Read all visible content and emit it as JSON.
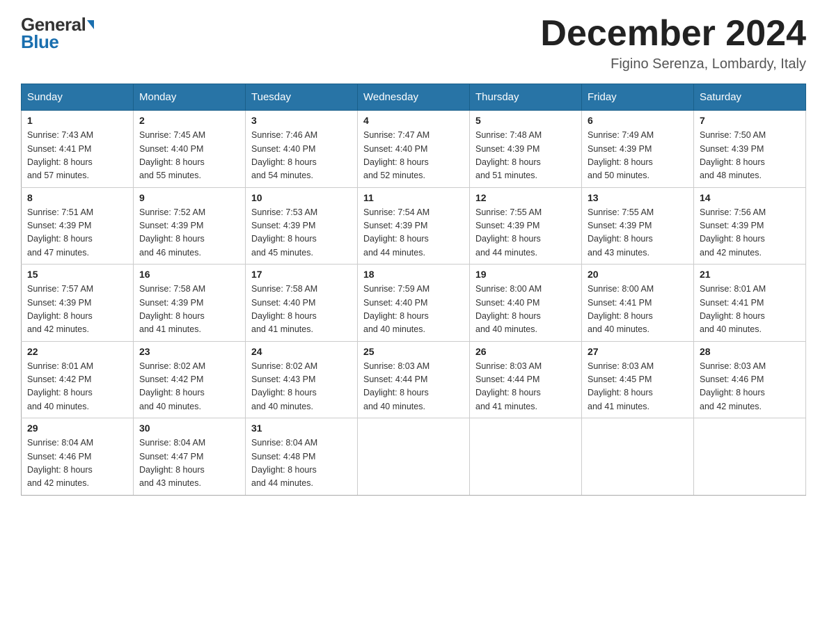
{
  "header": {
    "logo_general": "General",
    "logo_blue": "Blue",
    "month_title": "December 2024",
    "location": "Figino Serenza, Lombardy, Italy"
  },
  "days_of_week": [
    "Sunday",
    "Monday",
    "Tuesday",
    "Wednesday",
    "Thursday",
    "Friday",
    "Saturday"
  ],
  "weeks": [
    [
      {
        "day": "1",
        "sunrise": "7:43 AM",
        "sunset": "4:41 PM",
        "daylight": "8 hours and 57 minutes."
      },
      {
        "day": "2",
        "sunrise": "7:45 AM",
        "sunset": "4:40 PM",
        "daylight": "8 hours and 55 minutes."
      },
      {
        "day": "3",
        "sunrise": "7:46 AM",
        "sunset": "4:40 PM",
        "daylight": "8 hours and 54 minutes."
      },
      {
        "day": "4",
        "sunrise": "7:47 AM",
        "sunset": "4:40 PM",
        "daylight": "8 hours and 52 minutes."
      },
      {
        "day": "5",
        "sunrise": "7:48 AM",
        "sunset": "4:39 PM",
        "daylight": "8 hours and 51 minutes."
      },
      {
        "day": "6",
        "sunrise": "7:49 AM",
        "sunset": "4:39 PM",
        "daylight": "8 hours and 50 minutes."
      },
      {
        "day": "7",
        "sunrise": "7:50 AM",
        "sunset": "4:39 PM",
        "daylight": "8 hours and 48 minutes."
      }
    ],
    [
      {
        "day": "8",
        "sunrise": "7:51 AM",
        "sunset": "4:39 PM",
        "daylight": "8 hours and 47 minutes."
      },
      {
        "day": "9",
        "sunrise": "7:52 AM",
        "sunset": "4:39 PM",
        "daylight": "8 hours and 46 minutes."
      },
      {
        "day": "10",
        "sunrise": "7:53 AM",
        "sunset": "4:39 PM",
        "daylight": "8 hours and 45 minutes."
      },
      {
        "day": "11",
        "sunrise": "7:54 AM",
        "sunset": "4:39 PM",
        "daylight": "8 hours and 44 minutes."
      },
      {
        "day": "12",
        "sunrise": "7:55 AM",
        "sunset": "4:39 PM",
        "daylight": "8 hours and 44 minutes."
      },
      {
        "day": "13",
        "sunrise": "7:55 AM",
        "sunset": "4:39 PM",
        "daylight": "8 hours and 43 minutes."
      },
      {
        "day": "14",
        "sunrise": "7:56 AM",
        "sunset": "4:39 PM",
        "daylight": "8 hours and 42 minutes."
      }
    ],
    [
      {
        "day": "15",
        "sunrise": "7:57 AM",
        "sunset": "4:39 PM",
        "daylight": "8 hours and 42 minutes."
      },
      {
        "day": "16",
        "sunrise": "7:58 AM",
        "sunset": "4:39 PM",
        "daylight": "8 hours and 41 minutes."
      },
      {
        "day": "17",
        "sunrise": "7:58 AM",
        "sunset": "4:40 PM",
        "daylight": "8 hours and 41 minutes."
      },
      {
        "day": "18",
        "sunrise": "7:59 AM",
        "sunset": "4:40 PM",
        "daylight": "8 hours and 40 minutes."
      },
      {
        "day": "19",
        "sunrise": "8:00 AM",
        "sunset": "4:40 PM",
        "daylight": "8 hours and 40 minutes."
      },
      {
        "day": "20",
        "sunrise": "8:00 AM",
        "sunset": "4:41 PM",
        "daylight": "8 hours and 40 minutes."
      },
      {
        "day": "21",
        "sunrise": "8:01 AM",
        "sunset": "4:41 PM",
        "daylight": "8 hours and 40 minutes."
      }
    ],
    [
      {
        "day": "22",
        "sunrise": "8:01 AM",
        "sunset": "4:42 PM",
        "daylight": "8 hours and 40 minutes."
      },
      {
        "day": "23",
        "sunrise": "8:02 AM",
        "sunset": "4:42 PM",
        "daylight": "8 hours and 40 minutes."
      },
      {
        "day": "24",
        "sunrise": "8:02 AM",
        "sunset": "4:43 PM",
        "daylight": "8 hours and 40 minutes."
      },
      {
        "day": "25",
        "sunrise": "8:03 AM",
        "sunset": "4:44 PM",
        "daylight": "8 hours and 40 minutes."
      },
      {
        "day": "26",
        "sunrise": "8:03 AM",
        "sunset": "4:44 PM",
        "daylight": "8 hours and 41 minutes."
      },
      {
        "day": "27",
        "sunrise": "8:03 AM",
        "sunset": "4:45 PM",
        "daylight": "8 hours and 41 minutes."
      },
      {
        "day": "28",
        "sunrise": "8:03 AM",
        "sunset": "4:46 PM",
        "daylight": "8 hours and 42 minutes."
      }
    ],
    [
      {
        "day": "29",
        "sunrise": "8:04 AM",
        "sunset": "4:46 PM",
        "daylight": "8 hours and 42 minutes."
      },
      {
        "day": "30",
        "sunrise": "8:04 AM",
        "sunset": "4:47 PM",
        "daylight": "8 hours and 43 minutes."
      },
      {
        "day": "31",
        "sunrise": "8:04 AM",
        "sunset": "4:48 PM",
        "daylight": "8 hours and 44 minutes."
      },
      null,
      null,
      null,
      null
    ]
  ],
  "labels": {
    "sunrise": "Sunrise:",
    "sunset": "Sunset:",
    "daylight": "Daylight:"
  }
}
